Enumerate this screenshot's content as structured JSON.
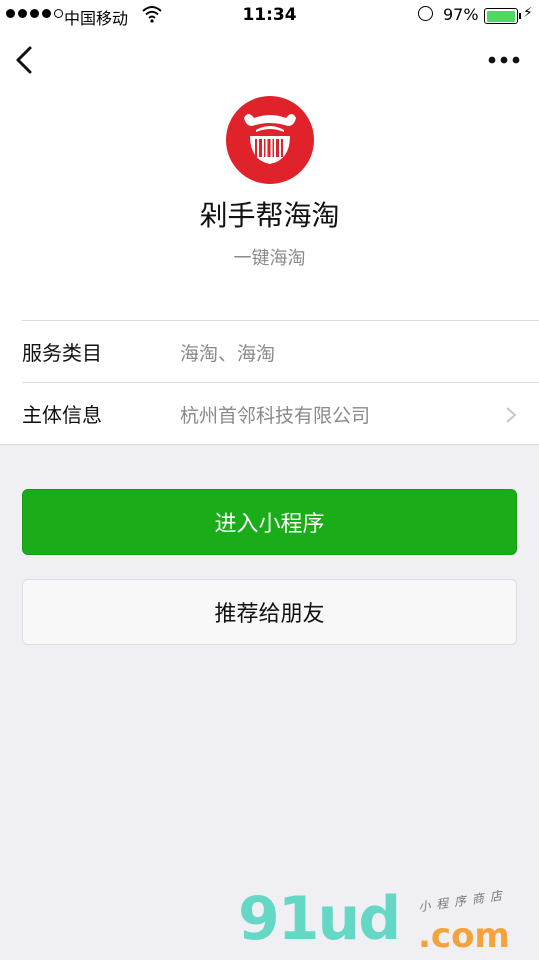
{
  "status_bar": {
    "signal_filled": 4,
    "signal_total": 5,
    "carrier": "中国移动",
    "time": "11:34",
    "battery_percent": "97%",
    "battery_level": 0.97,
    "icons": [
      "wifi-icon",
      "orientation-lock-icon",
      "battery-icon",
      "charging-icon"
    ]
  },
  "nav": {
    "back_icon": "chevron-left-icon",
    "more_icon": "more-dots-icon"
  },
  "profile": {
    "name": "剁手帮海淘",
    "description": "一键海淘",
    "logo_color": "#e0222b"
  },
  "info_rows": [
    {
      "label": "服务类目",
      "value": "海淘、海淘",
      "has_arrow": false
    },
    {
      "label": "主体信息",
      "value": "杭州首邻科技有限公司",
      "has_arrow": true
    }
  ],
  "actions": {
    "primary_label": "进入小程序",
    "secondary_label": "推荐给朋友",
    "primary_color": "#1aad19"
  },
  "watermark": {
    "logo_text": "91ud",
    "domain": ".com",
    "subtitle": "小程序商店"
  }
}
